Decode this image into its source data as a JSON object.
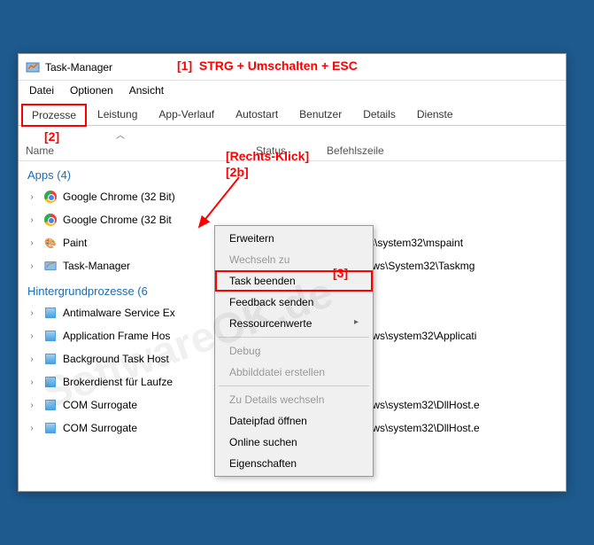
{
  "window": {
    "title": "Task-Manager"
  },
  "menubar": [
    "Datei",
    "Optionen",
    "Ansicht"
  ],
  "tabs": [
    "Prozesse",
    "Leistung",
    "App-Verlauf",
    "Autostart",
    "Benutzer",
    "Details",
    "Dienste"
  ],
  "columns": {
    "name": "Name",
    "status": "Status",
    "cmd": "Befehlszeile"
  },
  "groups": {
    "apps": {
      "label": "Apps (4)"
    },
    "bg": {
      "label": "Hintergrundprozesse (6"
    }
  },
  "apps": [
    {
      "name": "Google Chrome (32 Bit)",
      "cmd": "",
      "icon": "chrome"
    },
    {
      "name": "Google Chrome (32 Bit",
      "cmd": "",
      "icon": "chrome"
    },
    {
      "name": "Paint",
      "cmd": "\\Windows\\system32\\mspaint",
      "icon": "paint"
    },
    {
      "name": "Task-Manager",
      "cmd": "C:\\Windows\\System32\\Taskmg",
      "icon": "tm"
    }
  ],
  "bgprocs": [
    {
      "name": "Antimalware Service Ex",
      "cmd": ""
    },
    {
      "name": "Application Frame Hos",
      "cmd": "C:\\Windows\\system32\\Applicati"
    },
    {
      "name": "Background Task Host",
      "cmd": ""
    },
    {
      "name": "Brokerdienst für Laufze",
      "cmd": ""
    },
    {
      "name": "COM Surrogate",
      "cmd": "C:\\Windows\\system32\\DllHost.e"
    },
    {
      "name": "COM Surrogate",
      "cmd": "C:\\Windows\\system32\\DllHost.e"
    }
  ],
  "contextMenu": [
    {
      "label": "Erweitern",
      "enabled": true
    },
    {
      "label": "Wechseln zu",
      "enabled": false
    },
    {
      "label": "Task beenden",
      "enabled": true,
      "highlight": true
    },
    {
      "label": "Feedback senden",
      "enabled": true
    },
    {
      "label": "Ressourcenwerte",
      "enabled": true,
      "submenu": true
    },
    {
      "sep": true
    },
    {
      "label": "Debug",
      "enabled": false
    },
    {
      "label": "Abbilddatei erstellen",
      "enabled": false
    },
    {
      "sep": true
    },
    {
      "label": "Zu Details wechseln",
      "enabled": false
    },
    {
      "label": "Dateipfad öffnen",
      "enabled": true
    },
    {
      "label": "Online suchen",
      "enabled": true
    },
    {
      "label": "Eigenschaften",
      "enabled": true
    }
  ],
  "annotations": {
    "a1": "[1]",
    "a1b": "STRG + Umschalten + ESC",
    "a2": "[2]",
    "a2b_label": "[Rechts-Klick]",
    "a2b": "[2b]",
    "a3": "[3]"
  },
  "watermark": "SoftwareOK.de"
}
